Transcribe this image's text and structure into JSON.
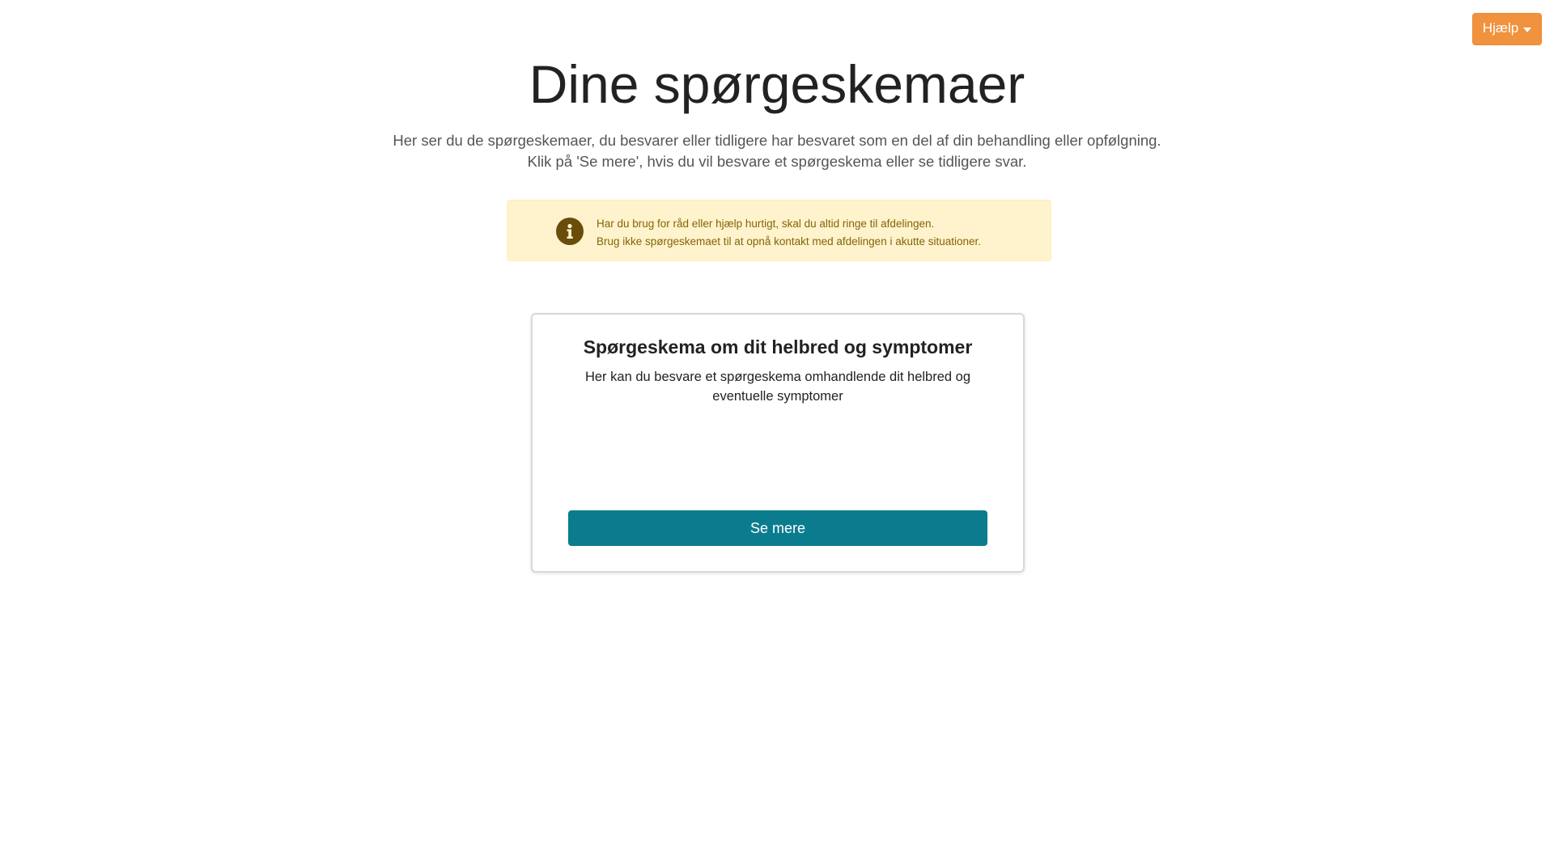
{
  "header": {
    "help_label": "Hjælp",
    "help_icon": "caret-down-icon",
    "help_color": "#f0923e"
  },
  "main": {
    "title": "Dine spørgeskemaer",
    "intro_line_1": "Her ser du de spørgeskemaer, du besvarer eller tidligere har besvaret som en del af din behandling eller opfølgning.",
    "intro_line_2": "Klik på 'Se mere', hvis du vil besvare et spørgeskema eller se tidligere svar."
  },
  "alert": {
    "icon": "info-icon",
    "line_1": "Har du brug for råd eller hjælp hurtigt, skal du altid ringe til afdelingen.",
    "line_2": "Brug ikke spørgeskemaet til at opnå kontakt med afdelingen i akutte situationer.",
    "background_color": "#fff3cd",
    "text_color": "#856404"
  },
  "questionnaires": [
    {
      "title": "Spørgeskema om dit helbred og symptomer",
      "description": "Her kan du besvare et spørgeskema omhandlende dit helbred og eventuelle symptomer",
      "button_label": "Se mere",
      "button_color": "#0b7c8e"
    }
  ]
}
